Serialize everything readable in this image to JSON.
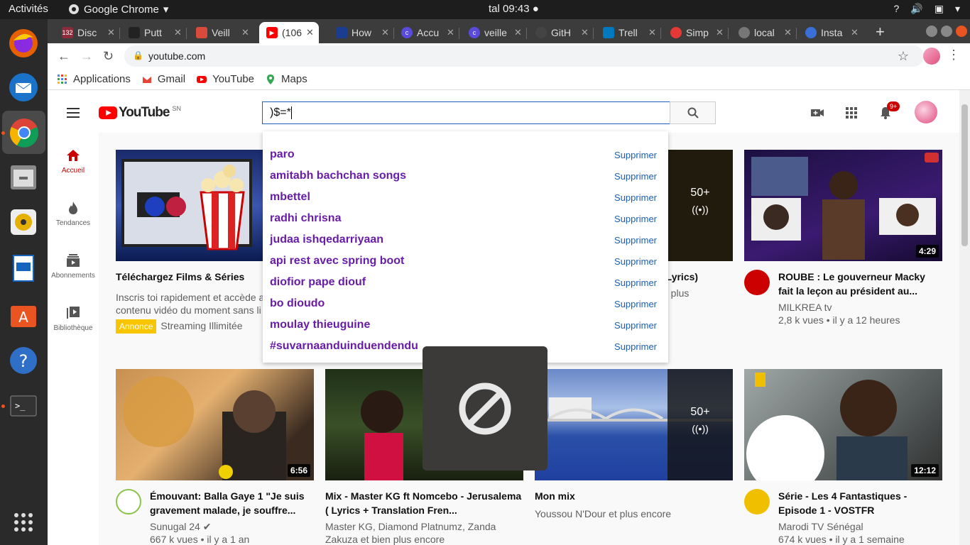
{
  "system": {
    "activities": "Activités",
    "app_name": "Google Chrome",
    "clock": "tal 09:43",
    "tray_help": "?"
  },
  "tabs": [
    {
      "title": "Disc",
      "badge": "132",
      "color": "#8e2b3a"
    },
    {
      "title": "Putt",
      "color": "#222222"
    },
    {
      "title": "Veill",
      "color": "#d94a3a"
    },
    {
      "title": "(106)",
      "color": "#ff0000",
      "active": true
    },
    {
      "title": "How",
      "color": "#1a3d8f"
    },
    {
      "title": "Accu",
      "color": "#5a4bdc"
    },
    {
      "title": "veille",
      "color": "#5a4bdc"
    },
    {
      "title": "GitH",
      "color": "#444444"
    },
    {
      "title": "Trell",
      "color": "#0079bf"
    },
    {
      "title": "Simp",
      "color": "#e53935"
    },
    {
      "title": "local",
      "color": "#777777"
    },
    {
      "title": "Insta",
      "color": "#3a6fd8"
    }
  ],
  "toolbar": {
    "url": "youtube.com"
  },
  "bookmarks": [
    {
      "label": "Applications"
    },
    {
      "label": "Gmail"
    },
    {
      "label": "YouTube"
    },
    {
      "label": "Maps"
    }
  ],
  "youtube": {
    "logo_text": "YouTube",
    "country": "SN",
    "search_value": ")$=*",
    "notification_count": "9+",
    "guide": [
      {
        "label": "Accueil"
      },
      {
        "label": "Tendances"
      },
      {
        "label": "Abonnements"
      },
      {
        "label": "Bibliothèque"
      }
    ],
    "suggestions": [
      "paro",
      "amitabh bachchan songs",
      "mbettel",
      "radhi chrisna",
      "judaa ishqedarriyaan",
      "api rest avec spring boot",
      "diofior pape diouf",
      "bo dioudo",
      "moulay thieuguine",
      "#suvarnaanduinduendendu"
    ],
    "suggestion_delete_label": "Supprimer",
    "videos": [
      {
        "title": "Téléchargez Films & Séries",
        "line1": "Inscris toi rapidement et accède a",
        "line2": "contenu vidéo du moment sans li",
        "ad_badge": "Annonce",
        "ad_text": "Streaming Illimitée"
      },
      {
        "partial_title": "(Lyrics)",
        "partial_meta": "n plus",
        "mix_count": "50+"
      },
      {
        "title": "ROUBE : Le gouverneur Macky fait la leçon au président au...",
        "channel": "MILKREA tv",
        "stats": "2,8 k vues • il y a 12 heures",
        "duration": "4:29"
      },
      {
        "title": "Émouvant: Balla Gaye 1 \"Je suis gravement malade, je souffre...",
        "channel": "Sunugal 24",
        "stats": "667 k vues • il y a 1 an",
        "duration": "6:56"
      },
      {
        "title": "Mix - Master KG ft Nomcebo - Jerusalema ( Lyrics + Translation Fren...",
        "channel": "Master KG, Diamond Platnumz, Zanda",
        "stats": "Zakuza et bien plus encore"
      },
      {
        "title": "Mon mix",
        "channel": "Youssou N'Dour et plus encore",
        "mix_count": "50+"
      },
      {
        "title": "Série - Les 4 Fantastiques - Episode 1 - VOSTFR",
        "channel": "Marodi TV Sénégal",
        "stats": "674 k vues • il y a 1 semaine",
        "duration": "12:12"
      }
    ]
  }
}
